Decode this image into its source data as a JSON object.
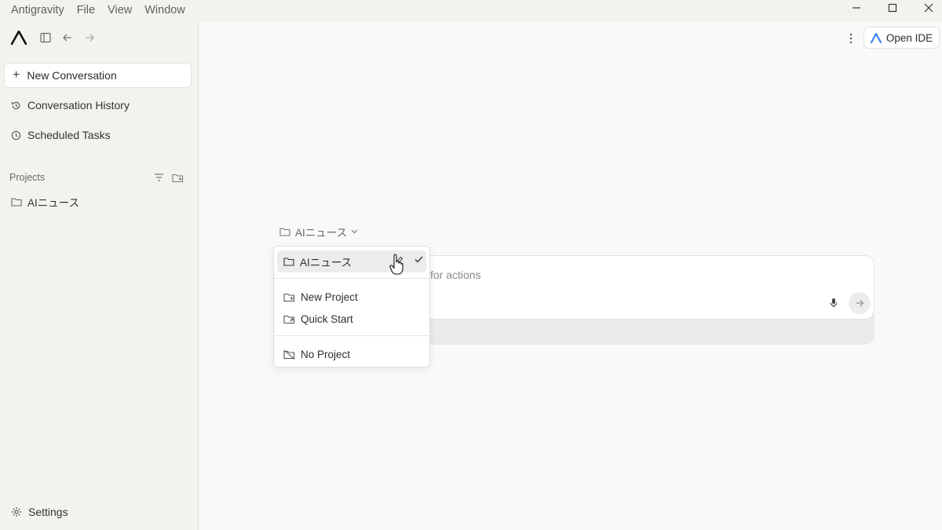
{
  "menubar": {
    "items": [
      "Antigravity",
      "File",
      "View",
      "Window"
    ]
  },
  "sidebar": {
    "new_conversation": "New Conversation",
    "nav": [
      {
        "label": "Conversation History",
        "icon": "history-icon"
      },
      {
        "label": "Scheduled Tasks",
        "icon": "clock-icon"
      }
    ],
    "projects_label": "Projects",
    "projects": [
      {
        "label": "AIニュース",
        "icon": "folder-icon"
      }
    ],
    "settings": "Settings"
  },
  "header": {
    "open_ide": "Open IDE"
  },
  "composer": {
    "selected_project": "AIニュース",
    "placeholder_visible": "for actions"
  },
  "project_dropdown": {
    "current": "AIニュース",
    "actions": [
      {
        "label": "New Project",
        "icon": "folder-plus-icon"
      },
      {
        "label": "Quick Start",
        "icon": "folder-arrow-icon"
      }
    ],
    "none": "No Project"
  },
  "colors": {
    "sidebar_bg": "#f3f2ee",
    "main_bg": "#f9f9f7",
    "accent": "#3b82f6"
  }
}
